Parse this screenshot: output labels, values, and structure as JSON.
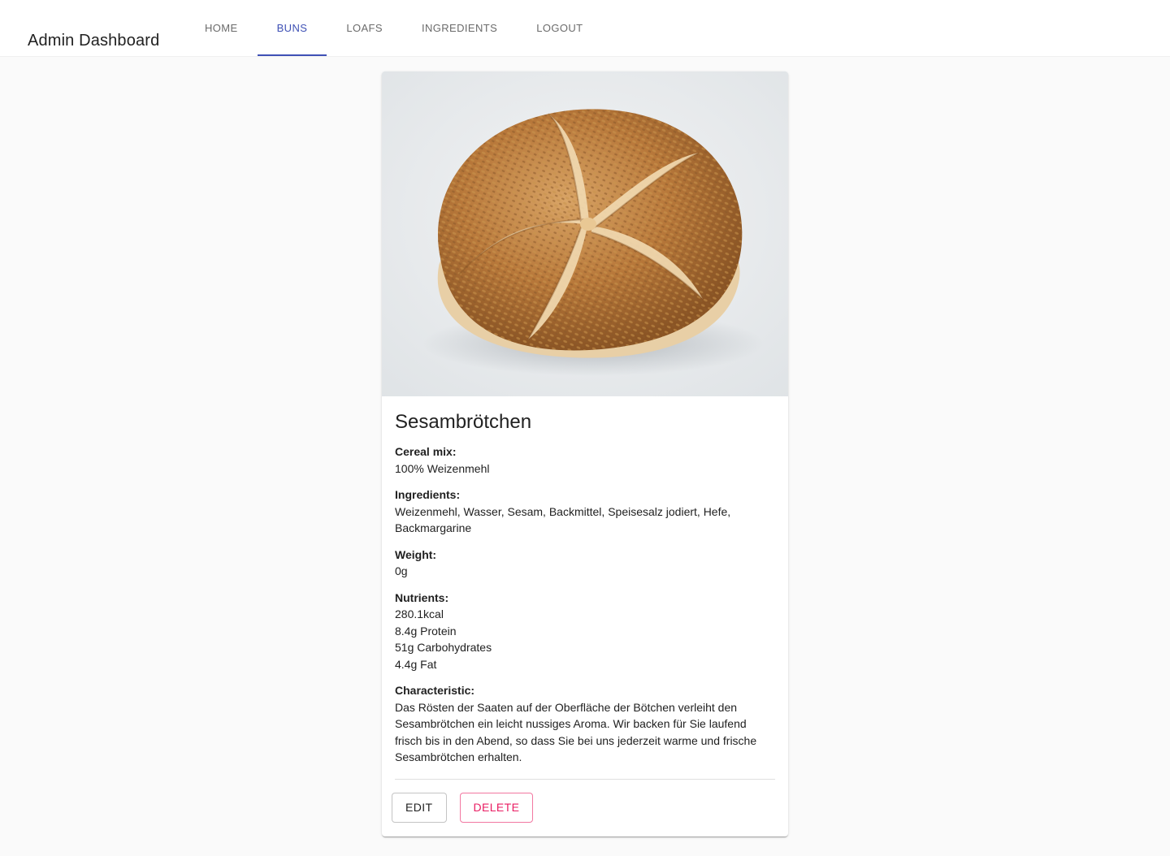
{
  "app": {
    "title": "Admin Dashboard"
  },
  "nav": {
    "tabs": [
      {
        "label": "HOME",
        "active": false
      },
      {
        "label": "BUNS",
        "active": true
      },
      {
        "label": "LOAFS",
        "active": false
      },
      {
        "label": "INGREDIENTS",
        "active": false
      },
      {
        "label": "LOGOUT",
        "active": false
      }
    ]
  },
  "product": {
    "name": "Sesambrötchen",
    "image_icon": "sesame-bun-photo",
    "fields": [
      {
        "label": "Cereal mix:",
        "lines": [
          "100% Weizenmehl"
        ]
      },
      {
        "label": "Ingredients:",
        "lines": [
          "Weizenmehl, Wasser, Sesam, Backmittel, Speisesalz jodiert, Hefe, Backmargarine"
        ]
      },
      {
        "label": "Weight:",
        "lines": [
          "0g"
        ]
      },
      {
        "label": "Nutrients:",
        "lines": [
          "280.1kcal",
          "8.4g Protein",
          "51g Carbohydrates",
          "4.4g Fat"
        ]
      },
      {
        "label": "Characteristic:",
        "lines": [
          "Das Rösten der Saaten auf der Oberfläche der Bötchen verleiht den Sesambrötchen ein leicht nussiges Aroma. Wir backen für Sie laufend frisch bis in den Abend, so dass Sie bei uns jederzeit warme und frische Sesambrötchen erhalten."
        ]
      }
    ]
  },
  "actions": {
    "edit_label": "EDIT",
    "delete_label": "DELETE"
  },
  "colors": {
    "primary": "#3f51b5",
    "secondary": "#e91e63",
    "background": "#fafafa"
  }
}
